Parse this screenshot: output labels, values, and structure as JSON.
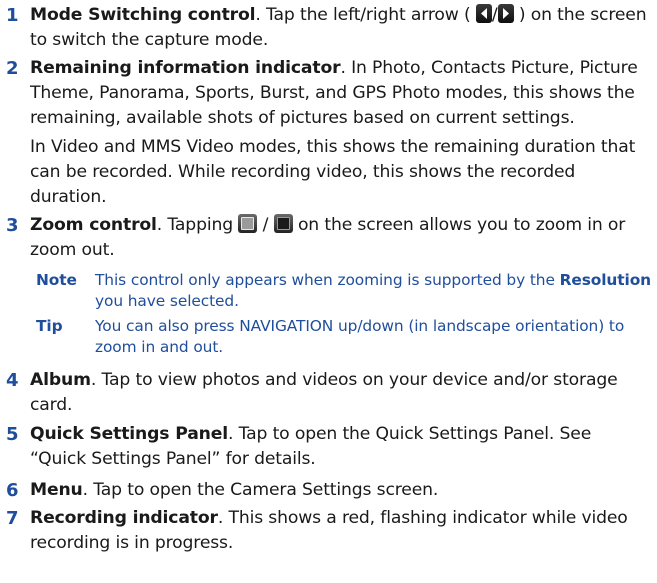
{
  "items": [
    {
      "number": "1",
      "title": "Mode Switching control",
      "text_a": ". Tap the left/right arrow (",
      "sep": "/",
      "text_b": ") on the screen to switch the capture mode."
    },
    {
      "number": "2",
      "title": "Remaining information indicator",
      "text": ". In Photo, Contacts Picture, Picture Theme, Panorama, Sports, Burst, and GPS Photo modes, this shows the remaining, available shots of pictures based on current settings.",
      "para2": "In Video and MMS Video modes, this shows the remaining duration that can be recorded. While recording video, this shows the recorded duration."
    },
    {
      "number": "3",
      "title": "Zoom control",
      "text_a": ". Tapping",
      "sep": "/",
      "text_b": "on the screen allows you to zoom in or zoom out."
    },
    {
      "number": "4",
      "title": "Album",
      "text": ". Tap to view photos and videos on your device and/or storage card."
    },
    {
      "number": "5",
      "title": "Quick Settings Panel",
      "text": ". Tap to open the Quick Settings Panel. See “Quick Settings Panel” for details."
    },
    {
      "number": "6",
      "title": "Menu",
      "text": ". Tap to open the Camera Settings screen."
    },
    {
      "number": "7",
      "title": "Recording indicator",
      "text": ". This shows a red, flashing indicator while video recording is in progress."
    }
  ],
  "note": {
    "label": "Note",
    "text_a": "This control only appears when zooming is supported by the",
    "bold": "Resolution",
    "text_b": "you have selected."
  },
  "tip": {
    "label": "Tip",
    "text": "You can also press NAVIGATION up/down (in landscape orientation) to zoom in and out."
  },
  "icons": [
    "left-arrow-icon",
    "right-arrow-icon",
    "zoom-in-icon",
    "zoom-out-icon"
  ],
  "colors": {
    "accent": "#1f4e9c",
    "text": "#1a1a1a"
  }
}
